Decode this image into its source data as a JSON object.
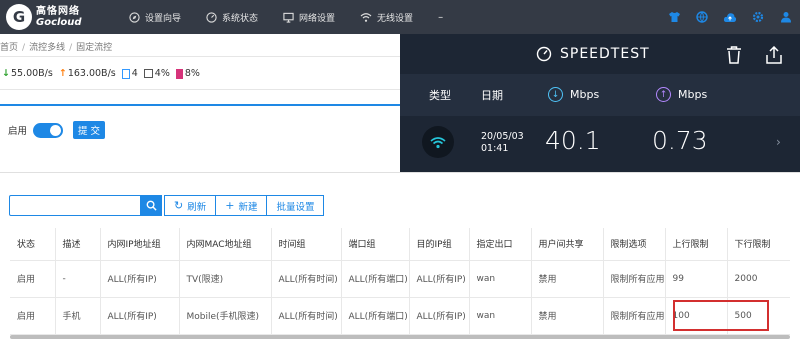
{
  "brand": {
    "name_cn": "高恪网络",
    "name_en": "Gocloud"
  },
  "nav": [
    {
      "label": "设置向导",
      "icon": "compass-icon"
    },
    {
      "label": "系统状态",
      "icon": "gauge-icon"
    },
    {
      "label": "网络设置",
      "icon": "monitor-icon"
    },
    {
      "label": "无线设置",
      "icon": "wifi-icon"
    }
  ],
  "nav_more": "–",
  "top_icons": [
    "shirt-icon",
    "globe-icon",
    "cloud-upload-icon",
    "settings-icon",
    "user-icon"
  ],
  "breadcrumb": [
    "首页",
    "流控多线",
    "固定流控"
  ],
  "stats": {
    "download": "55.00B/s",
    "upload": "163.00B/s",
    "conn": "4",
    "cpu": "4%",
    "mem": "8%"
  },
  "enable": {
    "label": "启用",
    "on": true,
    "submit": "提 交"
  },
  "speedtest": {
    "title": "SPEEDTEST",
    "col_type": "类型",
    "col_date": "日期",
    "col_download_unit": "Mbps",
    "col_upload_unit": "Mbps",
    "result": {
      "date": "20/05/03",
      "time": "01:41",
      "download": "40.1",
      "upload": "0.73"
    }
  },
  "toolbar": {
    "search_placeholder": "",
    "refresh": "刷新",
    "new": "新建",
    "batch": "批量设置"
  },
  "table": {
    "headers": [
      "状态",
      "描述",
      "内网IP地址组",
      "内网MAC地址组",
      "时间组",
      "端口组",
      "目的IP组",
      "指定出口",
      "用户间共享",
      "限制选项",
      "上行限制",
      "下行限制"
    ],
    "rows": [
      [
        "启用",
        "-",
        "ALL(所有IP)",
        "TV(限速)",
        "ALL(所有时间)",
        "ALL(所有端口)",
        "ALL(所有IP)",
        "wan",
        "禁用",
        "限制所有应用",
        "99",
        "2000"
      ],
      [
        "启用",
        "手机",
        "ALL(所有IP)",
        "Mobile(手机限速)",
        "ALL(所有时间)",
        "ALL(所有端口)",
        "ALL(所有IP)",
        "wan",
        "禁用",
        "限制所有应用",
        "100",
        "500"
      ]
    ]
  },
  "colors": {
    "topbar": "#343a45",
    "accent": "#1e88e5",
    "speed_bg": "#1d2634",
    "highlight": "#d32f2f"
  }
}
